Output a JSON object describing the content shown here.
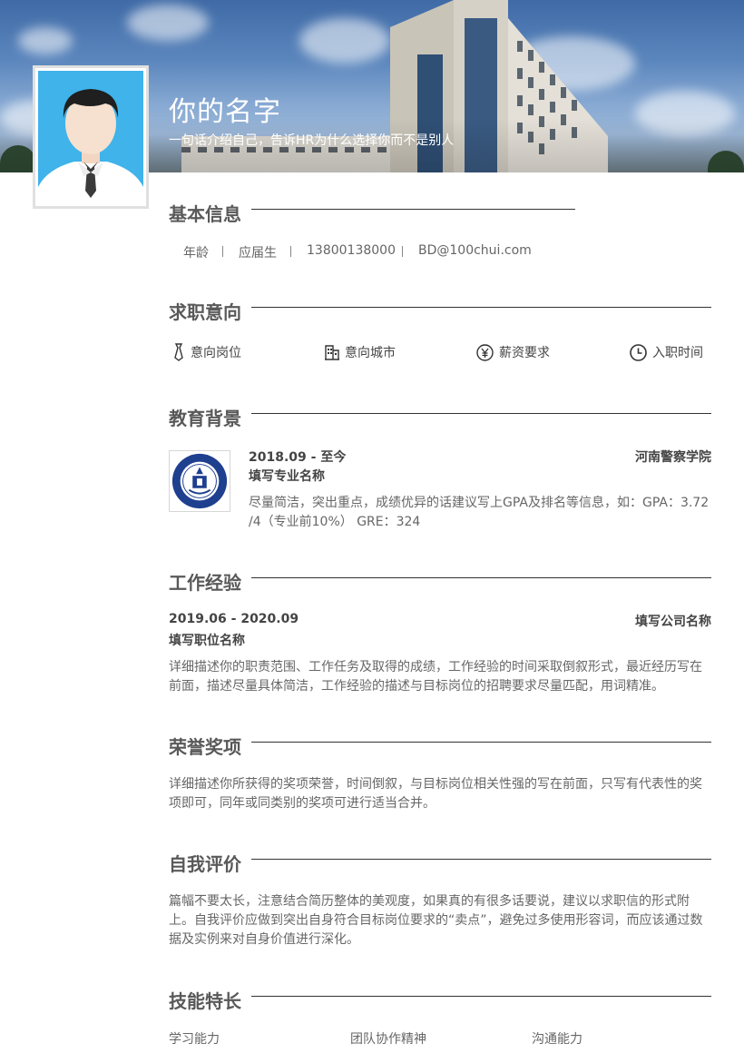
{
  "header": {
    "name": "你的名字",
    "tagline": "一句话介绍自己，告诉HR为什么选择你而不是别人"
  },
  "basic_info": {
    "title": "基本信息",
    "items": [
      "年龄",
      "应届生",
      "13800138000",
      "BD@100chui.com"
    ]
  },
  "job_intent": {
    "title": "求职意向",
    "items": [
      {
        "label": "意向岗位",
        "icon": "tie-icon"
      },
      {
        "label": "意向城市",
        "icon": "building-icon"
      },
      {
        "label": "薪资要求",
        "icon": "yen-icon"
      },
      {
        "label": "入职时间",
        "icon": "clock-icon"
      }
    ]
  },
  "education": {
    "title": "教育背景",
    "period": "2018.09 - 至今",
    "school": "河南警察学院",
    "major": "填写专业名称",
    "desc": "尽量简洁，突出重点，成绩优异的话建议写上GPA及排名等信息，如：GPA：3.72 /4（专业前10%） GRE：324"
  },
  "work": {
    "title": "工作经验",
    "period": "2019.06 - 2020.09",
    "company": "填写公司名称",
    "position": "填写职位名称",
    "desc": "详细描述你的职责范围、工作任务及取得的成绩，工作经验的时间采取倒叙形式，最近经历写在前面，描述尽量具体简洁，工作经验的描述与目标岗位的招聘要求尽量匹配，用词精准。"
  },
  "honors": {
    "title": "荣誉奖项",
    "desc": "详细描述你所获得的奖项荣誉，时间倒叙，与目标岗位相关性强的写在前面，只写有代表性的奖项即可，同年或同类别的奖项可进行适当合并。"
  },
  "self_eval": {
    "title": "自我评价",
    "desc": "篇幅不要太长，注意结合简历整体的美观度，如果真的有很多话要说，建议以求职信的形式附上。自我评价应做到突出自身符合目标岗位要求的“卖点”，避免过多使用形容词，而应该通过数据及实例来对自身价值进行深化。"
  },
  "skills": {
    "title": "技能特长",
    "items": [
      "学习能力",
      "团队协作精神",
      "沟通能力"
    ]
  }
}
